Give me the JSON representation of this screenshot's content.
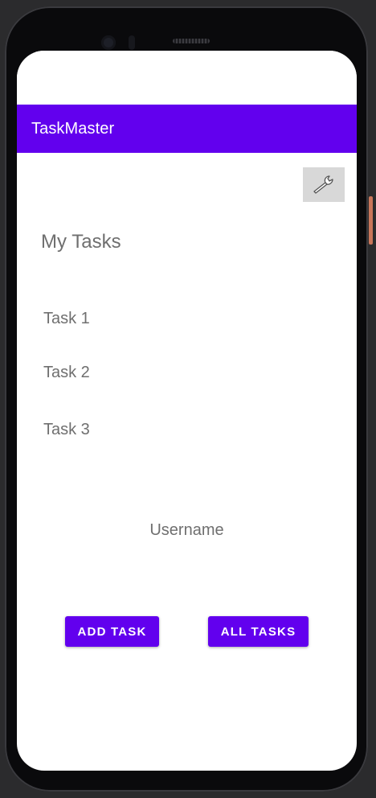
{
  "app_bar": {
    "title": "TaskMaster",
    "color": "#6200ee"
  },
  "toolbar": {
    "settings_icon": "wrench-icon"
  },
  "main": {
    "heading": "My Tasks",
    "tasks": [
      "Task 1",
      "Task 2",
      "Task 3"
    ],
    "username": "Username"
  },
  "actions": {
    "add_task_label": "ADD TASK",
    "all_tasks_label": "ALL TASKS"
  }
}
